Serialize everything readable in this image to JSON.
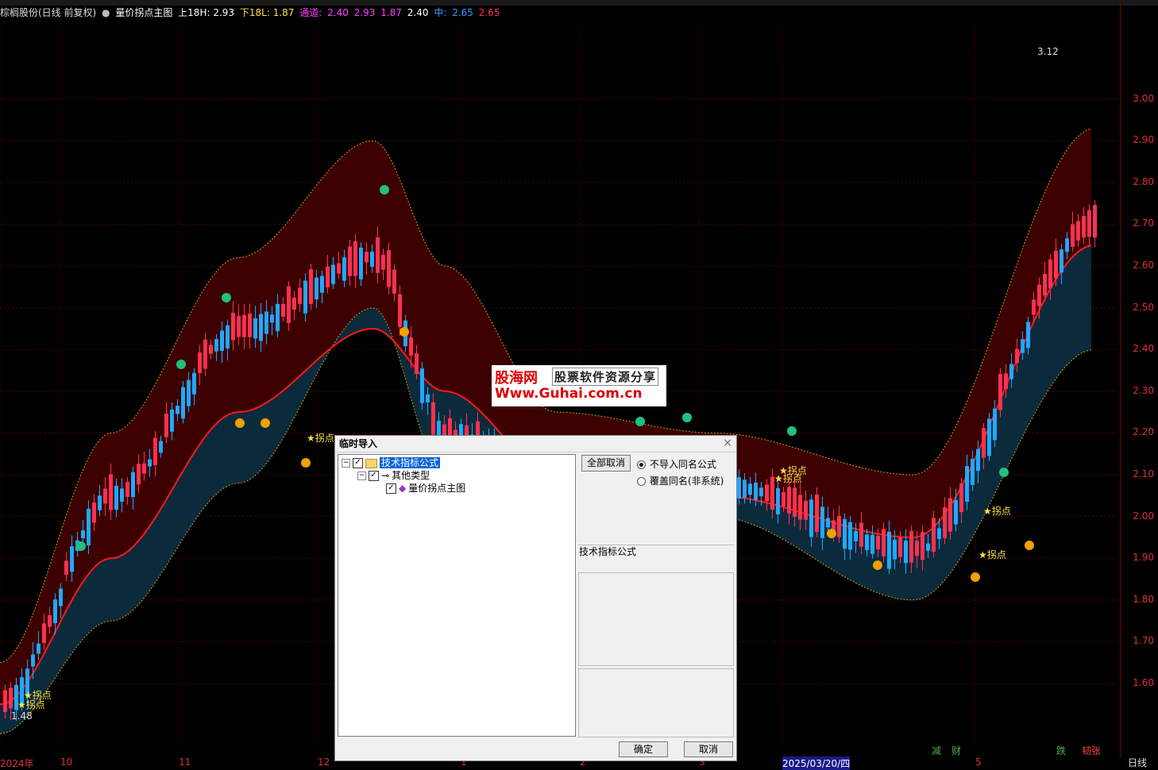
{
  "info_bar": {
    "stock": "棕榈股份(日线 前复权)",
    "indicator": "量价拐点主图",
    "upper": "上18H: 2.93",
    "lower": "下18L: 1.87",
    "channel_label": "通道:",
    "channel_values": [
      "2.40",
      "2.93",
      "1.87",
      "2.40"
    ],
    "mid_label": "中:",
    "mid_values": [
      "2.65",
      "2.65"
    ]
  },
  "colors": {
    "up": "#ff3050",
    "down": "#20a8ff",
    "ma": "#ff1a1a",
    "mid": "#3a9cff",
    "upper_band": "#3c0000",
    "lower_band": "#0b2a3c",
    "axis": "#e03030"
  },
  "price_axis": {
    "ticks": [
      "3.00",
      "2.90",
      "2.80",
      "2.70",
      "2.60",
      "2.50",
      "2.40",
      "2.30",
      "2.20",
      "2.10",
      "2.00",
      "1.90",
      "1.80",
      "1.70",
      "1.60"
    ]
  },
  "time_axis": {
    "labels": [
      "2024年",
      "10",
      "11",
      "12",
      "1",
      "2",
      "3",
      "2025/03/20/四",
      "5"
    ],
    "corner": "日线"
  },
  "annotations": {
    "high": "3.12",
    "low": "1.48",
    "pivot": "★拐点",
    "bottom_marks": [
      "减",
      "财",
      "跌",
      "韧张"
    ]
  },
  "watermark": {
    "cn": "股海网",
    "tag": "股票软件资源分享",
    "url": "Www.Guhai.com.cn"
  },
  "dialog": {
    "title": "临时导入",
    "close": "×",
    "tree": [
      "技术指标公式",
      "其他类型",
      "量价拐点主图"
    ],
    "deselect_all": "全部取消",
    "radio_options": [
      "不导入同名公式",
      "覆盖同名(非系统)"
    ],
    "category": "技术指标公式",
    "ok": "确定",
    "cancel": "取消"
  },
  "chart_data": {
    "type": "candlestick",
    "title": "",
    "ylim": [
      1.45,
      3.18
    ],
    "x": [
      "2024-09",
      "2024-10",
      "2024-11",
      "2024-12",
      "2025-01",
      "2025-02",
      "2025-03",
      "2025-04",
      "2025-05"
    ],
    "close": [
      1.55,
      2.05,
      2.45,
      2.62,
      2.2,
      2.1,
      2.08,
      1.92,
      2.7
    ],
    "ma": [
      1.55,
      1.9,
      2.25,
      2.45,
      2.3,
      2.1,
      2.05,
      1.95,
      2.65
    ],
    "upper_band": [
      1.65,
      2.2,
      2.62,
      2.9,
      2.6,
      2.25,
      2.2,
      2.1,
      2.93
    ],
    "lower_band": [
      1.48,
      1.75,
      2.08,
      2.5,
      2.1,
      2.02,
      2.0,
      1.8,
      2.4
    ]
  }
}
